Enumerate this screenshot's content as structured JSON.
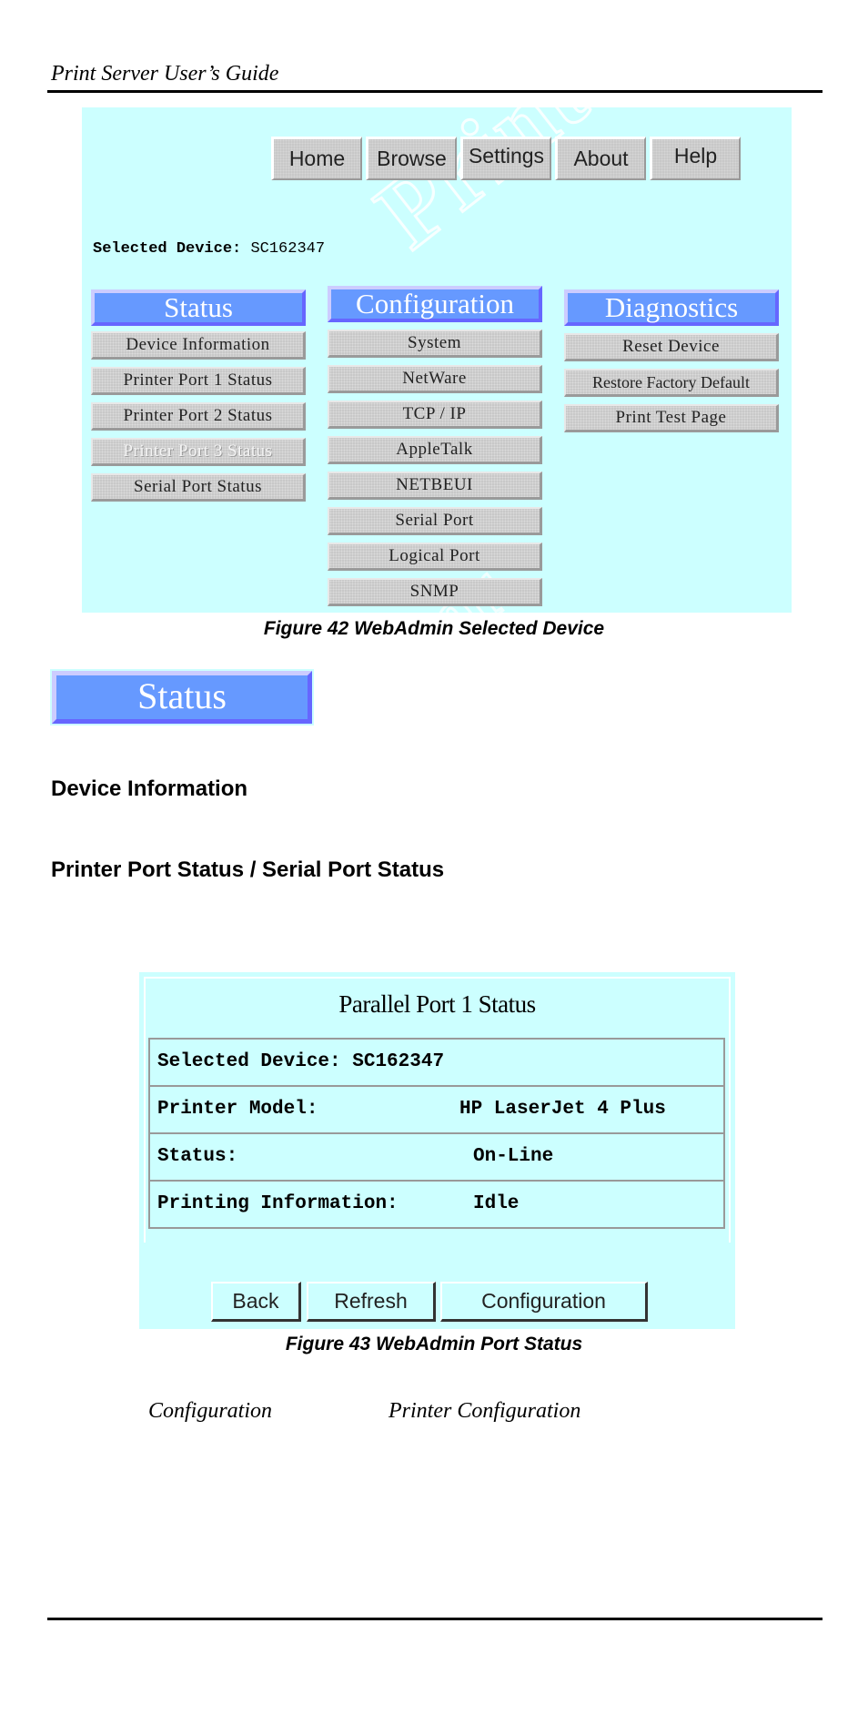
{
  "page": {
    "running_head": "Print Server User’s Guide"
  },
  "figure42": {
    "nav_tabs": [
      "Home",
      "Browse",
      "Settings",
      "About",
      "Help"
    ],
    "selected_device_label": "Selected Device:",
    "selected_device_value": "SC162347",
    "watermark": "PrintServer",
    "columns": [
      {
        "title": "Status",
        "items": [
          {
            "label": "Device Information",
            "enabled": true
          },
          {
            "label": "Printer Port 1 Status",
            "enabled": true
          },
          {
            "label": "Printer Port 2 Status",
            "enabled": true
          },
          {
            "label": "Printer Port 3 Status",
            "enabled": false
          },
          {
            "label": "Serial Port Status",
            "enabled": true
          }
        ]
      },
      {
        "title": "Configuration",
        "items": [
          {
            "label": "System",
            "enabled": true
          },
          {
            "label": "NetWare",
            "enabled": true
          },
          {
            "label": "TCP / IP",
            "enabled": true
          },
          {
            "label": "AppleTalk",
            "enabled": true
          },
          {
            "label": "NETBEUI",
            "enabled": true
          },
          {
            "label": "Serial Port",
            "enabled": true
          },
          {
            "label": "Logical Port",
            "enabled": true
          },
          {
            "label": "SNMP",
            "enabled": true
          }
        ]
      },
      {
        "title": "Diagnostics",
        "items": [
          {
            "label": "Reset Device",
            "enabled": true
          },
          {
            "label": "Restore Factory Default",
            "enabled": true
          },
          {
            "label": "Print Test Page",
            "enabled": true
          }
        ]
      }
    ],
    "caption": "Figure 42 WebAdmin Selected Device"
  },
  "status_block": {
    "label": "Status"
  },
  "headings": {
    "device_information": "Device Information",
    "port_status": "Printer Port Status / Serial Port Status"
  },
  "figure43": {
    "title": "Parallel Port 1 Status",
    "rows": [
      {
        "key": "Selected Device: SC162347",
        "value": ""
      },
      {
        "key": "Printer Model:",
        "value": "HP LaserJet 4 Plus"
      },
      {
        "key": "Status:",
        "value": "On-Line"
      },
      {
        "key": "Printing Information:",
        "value": "Idle"
      }
    ],
    "buttons": [
      "Back",
      "Refresh",
      "Configuration"
    ],
    "caption": "Figure 43 WebAdmin Port Status"
  },
  "footer_text": {
    "left": "Configuration",
    "right": "Printer Configuration"
  },
  "colors": {
    "panel_bg": "#ccffff",
    "header_blue": "#6699ff",
    "button_gray": "#c8c8c8"
  }
}
